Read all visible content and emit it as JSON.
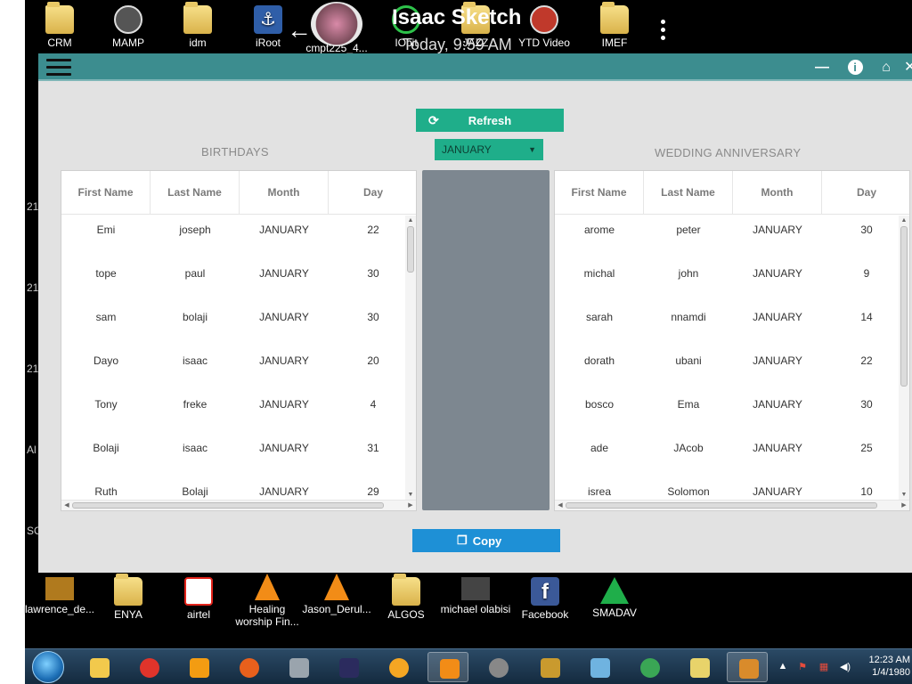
{
  "desktop": {
    "peek_labels": [
      "21",
      "21",
      "21",
      "Al",
      "SO"
    ],
    "top_icons": [
      {
        "label": "CRM",
        "icon": "folder-icon"
      },
      {
        "label": "MAMP",
        "icon": "mamp-icon"
      },
      {
        "label": "idm",
        "icon": "folder-icon"
      },
      {
        "label": "iRoot",
        "icon": "iroot-icon"
      },
      {
        "label": "cmpt225_4...",
        "icon": "photo-icon"
      },
      {
        "label": "IObit",
        "icon": "iobit-icon"
      },
      {
        "label": "JAZZ",
        "icon": "folder-icon"
      },
      {
        "label": "YTD Video",
        "icon": "ytd-icon"
      },
      {
        "label": "IMEF",
        "icon": "folder-icon"
      }
    ],
    "overlay_text": "Isaac Sketch",
    "overlay_date": "Today, 9:59 AM",
    "bottom_icons": [
      {
        "label": "lawrence_de...",
        "icon": "video-icon"
      },
      {
        "label": "ENYA",
        "icon": "folder-icon"
      },
      {
        "label": "airtel",
        "icon": "airtel-icon"
      },
      {
        "label": "Healing worship Fin...",
        "icon": "vlc-icon"
      },
      {
        "label": "Jason_Derul...",
        "icon": "vlc-icon"
      },
      {
        "label": "ALGOS",
        "icon": "folder-icon"
      },
      {
        "label": "michael olabisi",
        "icon": "video-icon"
      },
      {
        "label": "Facebook",
        "icon": "facebook-icon"
      },
      {
        "label": "SMADAV",
        "icon": "smadav-icon"
      }
    ]
  },
  "app": {
    "refresh_label": "Refresh",
    "month_selected": "JANUARY",
    "birthdays_title": "BIRTHDAYS",
    "wedding_title": "WEDDING ANNIVERSARY",
    "copy_label": "Copy",
    "birthdays": {
      "columns": [
        "First Name",
        "Last Name",
        "Month",
        "Day"
      ],
      "rows": [
        [
          "Emi",
          "joseph",
          "JANUARY",
          "22"
        ],
        [
          "tope",
          "paul",
          "JANUARY",
          "30"
        ],
        [
          "sam",
          "bolaji",
          "JANUARY",
          "30"
        ],
        [
          "Dayo",
          "isaac",
          "JANUARY",
          "20"
        ],
        [
          "Tony",
          "freke",
          "JANUARY",
          "4"
        ],
        [
          "Bolaji",
          "isaac",
          "JANUARY",
          "31"
        ],
        [
          "Ruth",
          "Bolaji",
          "JANUARY",
          "29"
        ]
      ]
    },
    "weddings": {
      "columns": [
        "First Name",
        "Last Name",
        "Month",
        "Day"
      ],
      "rows": [
        [
          "arome",
          "peter",
          "JANUARY",
          "30"
        ],
        [
          "michal",
          "john",
          "JANUARY",
          "9"
        ],
        [
          "sarah",
          "nnamdi",
          "JANUARY",
          "14"
        ],
        [
          "dorath",
          "ubani",
          "JANUARY",
          "22"
        ],
        [
          "bosco",
          "Ema",
          "JANUARY",
          "30"
        ],
        [
          "ade",
          "JAcob",
          "JANUARY",
          "25"
        ],
        [
          "isrea",
          "Solomon",
          "JANUARY",
          "10"
        ]
      ]
    }
  },
  "taskbar": {
    "items": [
      "explorer-icon",
      "opera-icon",
      "uc-browser-icon",
      "firefox-icon",
      "disk-icon",
      "intellij-icon",
      "game-icon",
      "vlc-icon",
      "media-icon",
      "sketch-icon",
      "paint-icon",
      "idm-icon",
      "folders-icon",
      "java-icon"
    ],
    "colors": [
      "#f2c94c",
      "#e0342b",
      "#f39c12",
      "#e8601c",
      "#9aa4ad",
      "#2b2b5e",
      "#f5a623",
      "#f28c17",
      "#888888",
      "#c99a2e",
      "#6fb3e0",
      "#3aa655",
      "#e8d36a",
      "#d98b2b"
    ],
    "time": "12:23 AM",
    "date": "1/4/1980"
  }
}
